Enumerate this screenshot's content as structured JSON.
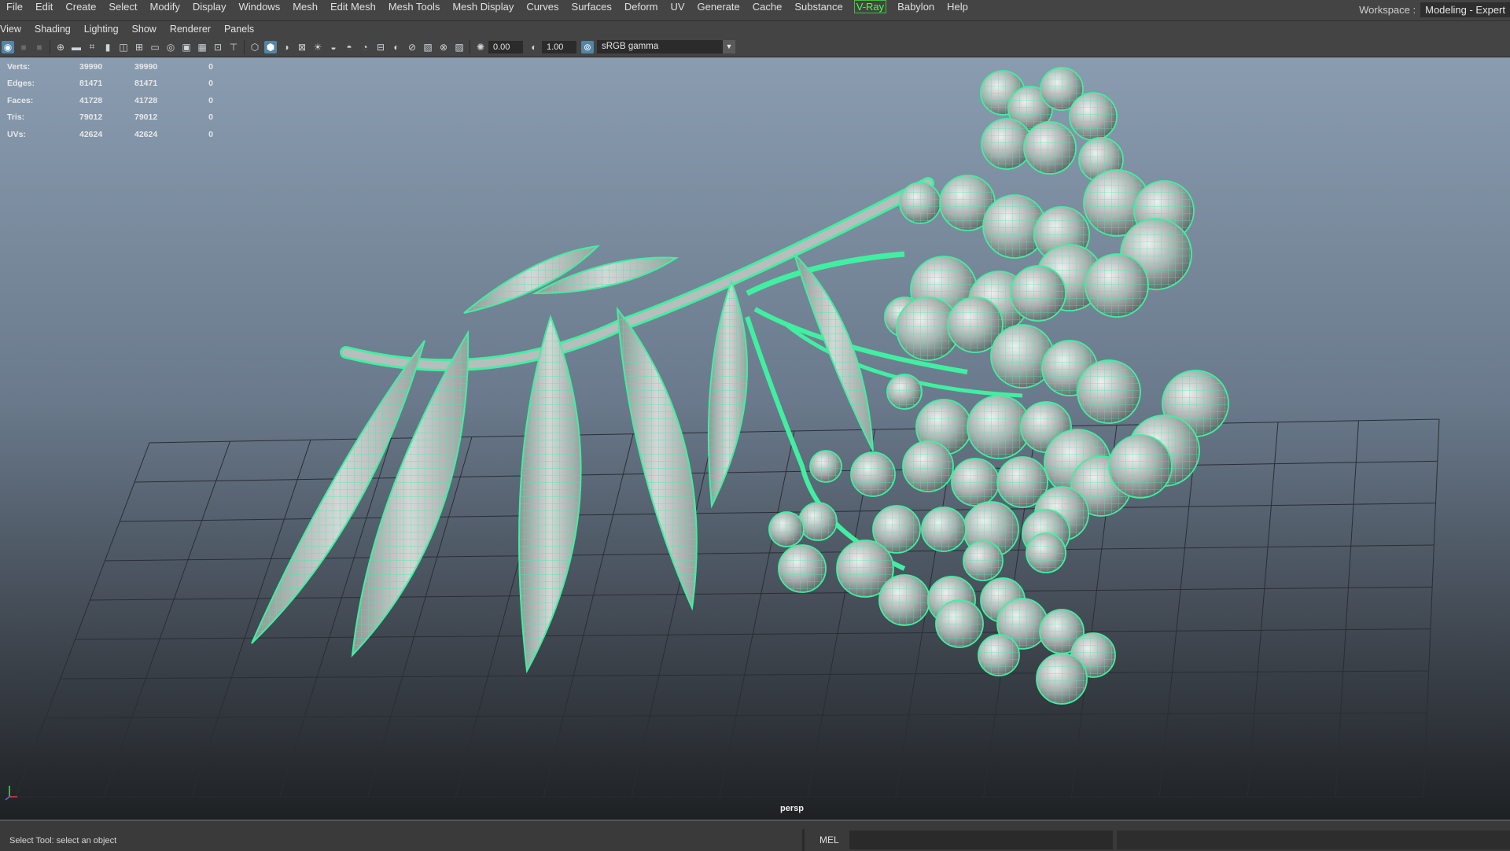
{
  "menubar": {
    "items": [
      "File",
      "Edit",
      "Create",
      "Select",
      "Modify",
      "Display",
      "Windows",
      "Mesh",
      "Edit Mesh",
      "Mesh Tools",
      "Mesh Display",
      "Curves",
      "Surfaces",
      "Deform",
      "UV",
      "Generate",
      "Cache",
      "Substance",
      "V-Ray",
      "Babylon",
      "Help"
    ],
    "workspace_label": "Workspace :",
    "workspace_value": "Modeling - Expert"
  },
  "panel_menu": {
    "items": [
      "View",
      "Shading",
      "Lighting",
      "Show",
      "Renderer",
      "Panels"
    ]
  },
  "toolbar": {
    "exposure": "0.00",
    "gamma": "1.00",
    "color_space": "sRGB gamma",
    "icons": [
      "select-camera-icon",
      "lock-camera-icon",
      "camera-attributes-icon",
      "bookmark-icon",
      "image-plane-icon",
      "grid-icon",
      "film-gate-icon",
      "resolution-gate-icon",
      "gate-mask-icon",
      "field-chart-icon",
      "safe-action-icon",
      "safe-title-icon",
      "wireframe-icon",
      "smooth-shade-icon",
      "default-material-icon",
      "textured-icon",
      "use-lights-icon",
      "shadows-icon",
      "screen-ao-icon",
      "motion-blur-icon",
      "antialias-icon",
      "depth-of-field-icon",
      "isolate-icon",
      "xray-icon",
      "xray-joints-icon",
      "backface-icon"
    ]
  },
  "hud": {
    "rows": [
      {
        "label": "Verts:",
        "v1": "39990",
        "v2": "39990",
        "v3": "0"
      },
      {
        "label": "Edges:",
        "v1": "81471",
        "v2": "81471",
        "v3": "0"
      },
      {
        "label": "Faces:",
        "v1": "41728",
        "v2": "41728",
        "v3": "0"
      },
      {
        "label": "Tris:",
        "v1": "79012",
        "v2": "79012",
        "v3": "0"
      },
      {
        "label": "UVs:",
        "v1": "42624",
        "v2": "42624",
        "v3": "0"
      }
    ]
  },
  "viewport": {
    "camera": "persp",
    "wire_color": "#40f0a0"
  },
  "statusbar": {
    "help_text": "Select Tool: select an object",
    "mel_label": "MEL"
  }
}
